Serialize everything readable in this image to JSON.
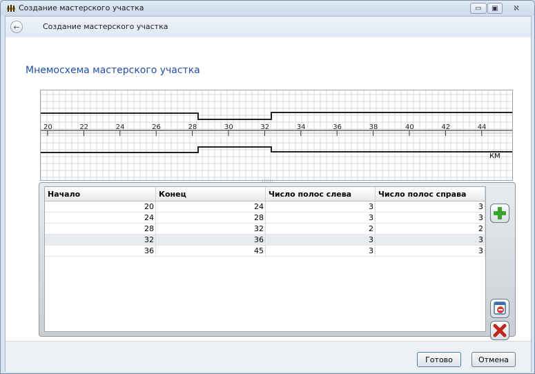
{
  "window": {
    "title": "Создание мастерского участка",
    "controls": {
      "minimize": "▭",
      "maximize": "▣",
      "close": "ℵ"
    }
  },
  "nav": {
    "back_icon": "arrow-left-icon",
    "title": "Создание мастерского участка"
  },
  "page": {
    "heading": "Мнемосхема мастерского участка"
  },
  "diagram": {
    "axis_labels": [
      "20",
      "22",
      "24",
      "26",
      "28",
      "30",
      "32",
      "34",
      "36",
      "38",
      "40",
      "42",
      "44"
    ],
    "unit_label": "КМ",
    "splitter_grip": "IIIIII"
  },
  "table": {
    "columns": [
      "Начало",
      "Конец",
      "Число полос слева",
      "Число полос справа"
    ],
    "rows": [
      [
        "20",
        "24",
        "3",
        "3"
      ],
      [
        "24",
        "28",
        "3",
        "3"
      ],
      [
        "28",
        "32",
        "2",
        "2"
      ],
      [
        "32",
        "36",
        "3",
        "3"
      ],
      [
        "36",
        "45",
        "3",
        "3"
      ]
    ],
    "selected_row": 3
  },
  "side_buttons": {
    "add_icon": "add-icon",
    "remove_icon": "remove-row-icon",
    "delete_icon": "delete-icon"
  },
  "footer": {
    "done_label": "Готово",
    "cancel_label": "Отмена"
  },
  "colors": {
    "heading": "#1f4fa8",
    "add": "#3aa52c",
    "delete": "#c0261c"
  }
}
